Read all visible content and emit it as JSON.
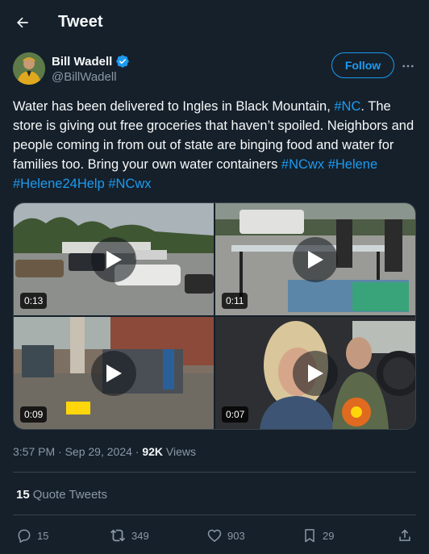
{
  "header": {
    "title": "Tweet",
    "back_icon": "arrow-left-icon"
  },
  "author": {
    "name": "Bill Wadell",
    "handle": "@BillWadell",
    "verified": true,
    "verified_color": "#1d9bf0",
    "avatar_icon": "user-avatar"
  },
  "follow_label": "Follow",
  "more_icon": "more-horizontal-icon",
  "tweet": {
    "text_parts": [
      {
        "type": "text",
        "value": "Water has been delivered to Ingles in Black Mountain, "
      },
      {
        "type": "hashtag",
        "value": "#NC"
      },
      {
        "type": "text",
        "value": ". The store is giving out free groceries that haven’t spoiled. Neighbors and people coming in from out of state are binging food and water for families too. Bring your own water containers "
      },
      {
        "type": "hashtag",
        "value": "#NCwx"
      },
      {
        "type": "text",
        "value": " "
      },
      {
        "type": "hashtag",
        "value": "#Helene"
      },
      {
        "type": "text",
        "value": " "
      },
      {
        "type": "hashtag",
        "value": "#Helene24Help"
      },
      {
        "type": "text",
        "value": " "
      },
      {
        "type": "hashtag",
        "value": "#NCwx"
      }
    ]
  },
  "media": [
    {
      "duration": "0:13",
      "play_icon": "play-icon"
    },
    {
      "duration": "0:11",
      "play_icon": "play-icon"
    },
    {
      "duration": "0:09",
      "play_icon": "play-icon"
    },
    {
      "duration": "0:07",
      "play_icon": "play-icon"
    }
  ],
  "meta": {
    "time": "3:57 PM",
    "separator": "·",
    "date": "Sep 29, 2024",
    "views_count": "92K",
    "views_label": "Views"
  },
  "quotes": {
    "count": "15",
    "label": "Quote Tweets"
  },
  "actions": {
    "replies": "15",
    "retweets": "349",
    "likes": "903",
    "bookmarks": "29"
  },
  "colors": {
    "background": "#15202b",
    "accent": "#1d9bf0",
    "secondary_text": "#8b98a5",
    "border": "#38444d"
  }
}
